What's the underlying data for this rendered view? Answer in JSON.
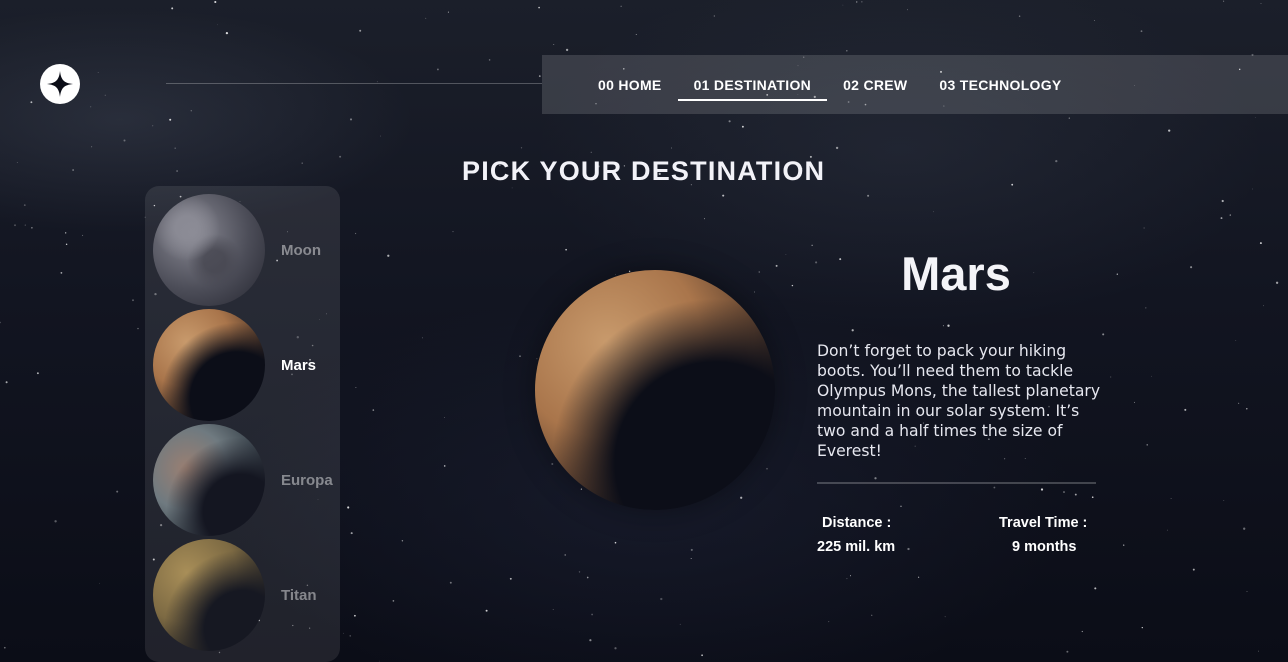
{
  "nav": {
    "items": [
      {
        "label": "00 HOME",
        "active": false
      },
      {
        "label": "01 DESTINATION",
        "active": true
      },
      {
        "label": "02 CREW",
        "active": false
      },
      {
        "label": "03 TECHNOLOGY",
        "active": false
      }
    ]
  },
  "logo": {
    "icon": "four-point-star-icon"
  },
  "page_title": "PICK YOUR DESTINATION",
  "destinations": [
    {
      "name": "Moon",
      "active": false
    },
    {
      "name": "Mars",
      "active": true
    },
    {
      "name": "Europa",
      "active": false
    },
    {
      "name": "Titan",
      "active": false
    }
  ],
  "selected": {
    "name": "Mars",
    "description": "Don’t forget to pack your hiking boots. You’ll need them to tackle Olympus Mons, the tallest planetary mountain in our solar system. It’s two and a half times the size of Everest!",
    "distance_label": "Distance :",
    "distance_value": "225 mil. km",
    "travel_label": "Travel Time :",
    "travel_value": "9 months"
  },
  "colors": {
    "background": "#0b0d17",
    "text": "#ffffff",
    "nav_bg": "rgba(255,255,255,0.14)"
  }
}
